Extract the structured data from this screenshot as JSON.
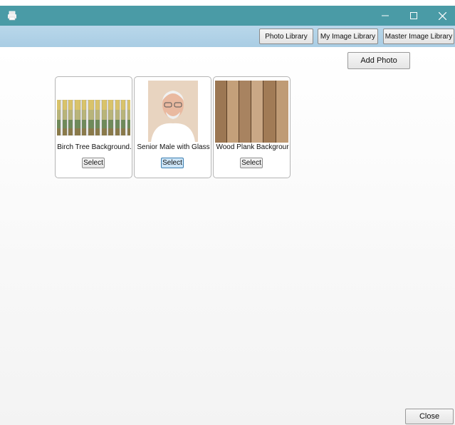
{
  "toolbar": {
    "photo_library": "Photo Library",
    "my_image_library": "My Image Library",
    "master_image_library": "Master Image Library"
  },
  "add_photo_label": "Add Photo",
  "cards": [
    {
      "label": "Birch Tree Background.",
      "select_label": "Select",
      "image": "birch-trees"
    },
    {
      "label": "Senior Male with Glass",
      "select_label": "Select",
      "image": "senior-male-portrait"
    },
    {
      "label": "Wood Plank Backgrour",
      "select_label": "Select",
      "image": "wood-planks"
    }
  ],
  "close_label": "Close",
  "colors": {
    "titlebar": "#4a9ba6",
    "toolbar": "#b9d7ea"
  }
}
